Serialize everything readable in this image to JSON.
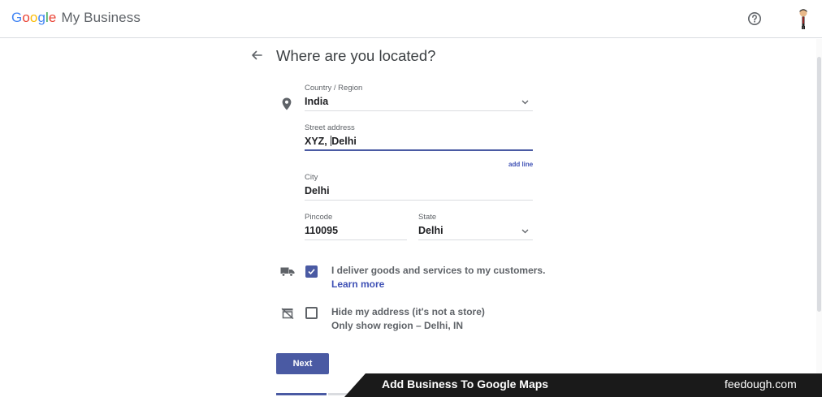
{
  "header": {
    "logo_letters": [
      {
        "ch": "G",
        "color": "#4285f4"
      },
      {
        "ch": "o",
        "color": "#ea4335"
      },
      {
        "ch": "o",
        "color": "#fbbc05"
      },
      {
        "ch": "g",
        "color": "#4285f4"
      },
      {
        "ch": "l",
        "color": "#34a853"
      },
      {
        "ch": "e",
        "color": "#ea4335"
      }
    ],
    "product": "My Business",
    "help_icon": "help-circle-icon",
    "avatar_icon": "user-avatar-icon"
  },
  "page": {
    "title": "Where are you located?",
    "back_icon": "arrow-back-icon"
  },
  "form": {
    "country": {
      "label": "Country / Region",
      "value": "India",
      "icon": "location-pin-icon"
    },
    "street": {
      "label": "Street address",
      "value_before_caret": "XYZ, ",
      "value_after_caret": "Delhi"
    },
    "add_line": "add line",
    "city": {
      "label": "City",
      "value": "Delhi"
    },
    "pincode": {
      "label": "Pincode",
      "value": "110095"
    },
    "state": {
      "label": "State",
      "value": "Delhi"
    }
  },
  "options": {
    "deliver": {
      "icon": "delivery-truck-icon",
      "checked": true,
      "text": "I deliver goods and services to my customers.",
      "link": "Learn more"
    },
    "hide": {
      "icon": "hidden-store-icon",
      "checked": false,
      "text": "Hide my address (it's not a store)",
      "subtext": "Only show region – Delhi, IN"
    }
  },
  "actions": {
    "next_label": "Next"
  },
  "banner": {
    "title": "Add Business To Google Maps",
    "site": "feedough.com"
  },
  "colors": {
    "accent": "#4a5aa3",
    "link": "#3f51b5",
    "divider": "#dadce0",
    "banner_bg": "#1a1a1a"
  }
}
